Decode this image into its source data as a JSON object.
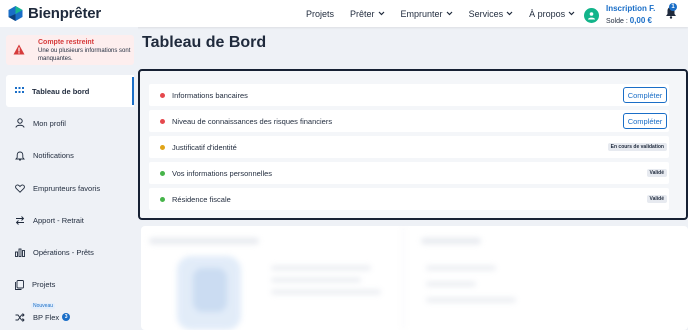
{
  "header": {
    "brand": "Bienprêter",
    "nav": [
      {
        "label": "Projets",
        "has_menu": false
      },
      {
        "label": "Prêter",
        "has_menu": true
      },
      {
        "label": "Emprunter",
        "has_menu": true
      },
      {
        "label": "Services",
        "has_menu": true
      },
      {
        "label": "À propos",
        "has_menu": true
      }
    ],
    "user": {
      "name": "Inscription F.",
      "balance_label": "Solde :",
      "balance_value": "0,00 €"
    },
    "notifications_count": "1",
    "accent_color": "#1a6ec7"
  },
  "sidebar": {
    "alert": {
      "title": "Compte restreint",
      "description": "Une ou plusieurs informations sont manquantes."
    },
    "items": [
      {
        "label": "Tableau de bord",
        "icon": "grid-icon",
        "active": true
      },
      {
        "label": "Mon profil",
        "icon": "user-icon"
      },
      {
        "label": "Notifications",
        "icon": "bell-icon"
      },
      {
        "label": "Emprunteurs favoris",
        "icon": "heart-icon"
      },
      {
        "label": "Apport - Retrait",
        "icon": "transfer-icon"
      },
      {
        "label": "Opérations - Prêts",
        "icon": "bar-chart-icon"
      },
      {
        "label": "Projets",
        "icon": "document-icon"
      },
      {
        "label": "BP Flex",
        "icon": "shuffle-icon",
        "new_label": "Nouveau",
        "badge": "3"
      }
    ]
  },
  "main": {
    "title": "Tableau de Bord",
    "checklist": [
      {
        "label": "Informations bancaires",
        "status_color": "#e5484d",
        "action": "Compléter"
      },
      {
        "label": "Niveau de connaissances des risques financiers",
        "status_color": "#e5484d",
        "action": "Compléter"
      },
      {
        "label": "Justificatif d'identité",
        "status_color": "#e0a418",
        "tag": "En cours de validation"
      },
      {
        "label": "Vos informations personnelles",
        "status_color": "#46b44a",
        "tag": "Validé"
      },
      {
        "label": "Résidence fiscale",
        "status_color": "#46b44a",
        "tag": "Validé"
      }
    ]
  }
}
